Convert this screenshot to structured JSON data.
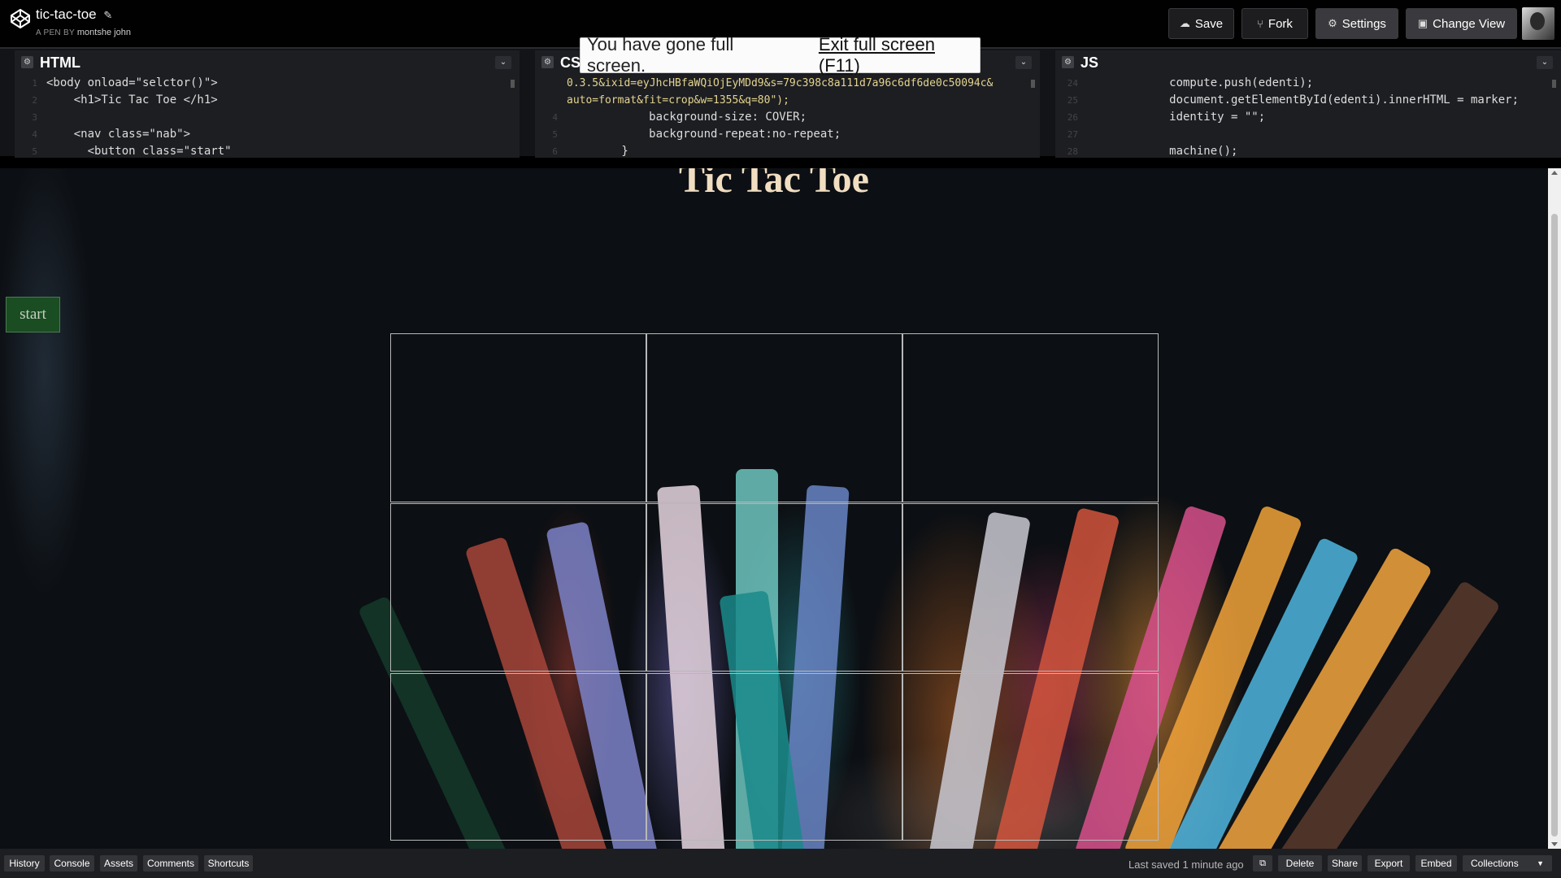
{
  "header": {
    "title": "tic-tac-toe",
    "author_prefix": "A PEN BY",
    "author": "montshe john",
    "buttons": {
      "save": "Save",
      "fork": "Fork",
      "settings": "Settings",
      "change_view": "Change View"
    },
    "icons": {
      "logo": "codepen-logo-icon",
      "edit": "pencil-icon",
      "save": "cloud-icon",
      "fork": "fork-icon",
      "settings": "gear-icon",
      "change_view": "layout-icon"
    }
  },
  "fullscreen_toast": {
    "message": "You have gone full screen.",
    "exit": "Exit full screen (F11)"
  },
  "editors": {
    "html": {
      "title": "HTML",
      "lines": [
        {
          "n": "1",
          "code": "<body onload=\"selctor()\">"
        },
        {
          "n": "2",
          "code": "    <h1>Tic Tac Toe </h1>"
        },
        {
          "n": "3",
          "code": ""
        },
        {
          "n": "4",
          "code": "    <nav class=\"nab\">"
        },
        {
          "n": "5",
          "code": "      <button class=\"start\""
        }
      ]
    },
    "css": {
      "title": "CSS",
      "lines": [
        {
          "n": "",
          "code": "0.3.5&ixid=eyJhcHBfaWQiOjEyMDd9&s=79c398c8a111d7a96c6df6de0c50094c&"
        },
        {
          "n": "",
          "code": "auto=format&fit=crop&w=1355&q=80\");"
        },
        {
          "n": "4",
          "code": "            background-size: COVER;"
        },
        {
          "n": "5",
          "code": "            background-repeat:no-repeat;"
        },
        {
          "n": "6",
          "code": "        }"
        }
      ]
    },
    "js": {
      "title": "JS",
      "lines": [
        {
          "n": "24",
          "code": "            compute.push(edenti);"
        },
        {
          "n": "25",
          "code": "            document.getElementById(edenti).innerHTML = marker;"
        },
        {
          "n": "26",
          "code": "            identity = \"\";"
        },
        {
          "n": "27",
          "code": ""
        },
        {
          "n": "28",
          "code": "            machine();"
        }
      ]
    }
  },
  "preview": {
    "heading": "Tic Tac Toe",
    "start_button": "start",
    "board": [
      "",
      "",
      "",
      "",
      "",
      "",
      "",
      "",
      ""
    ]
  },
  "footer": {
    "left": [
      "History",
      "Console",
      "Assets",
      "Comments",
      "Shortcuts"
    ],
    "last_saved": "Last saved 1 minute ago",
    "open_icon": "external-link-icon",
    "right": {
      "delete": "Delete",
      "share": "Share",
      "export": "Export",
      "embed": "Embed",
      "collections": "Collections"
    }
  }
}
